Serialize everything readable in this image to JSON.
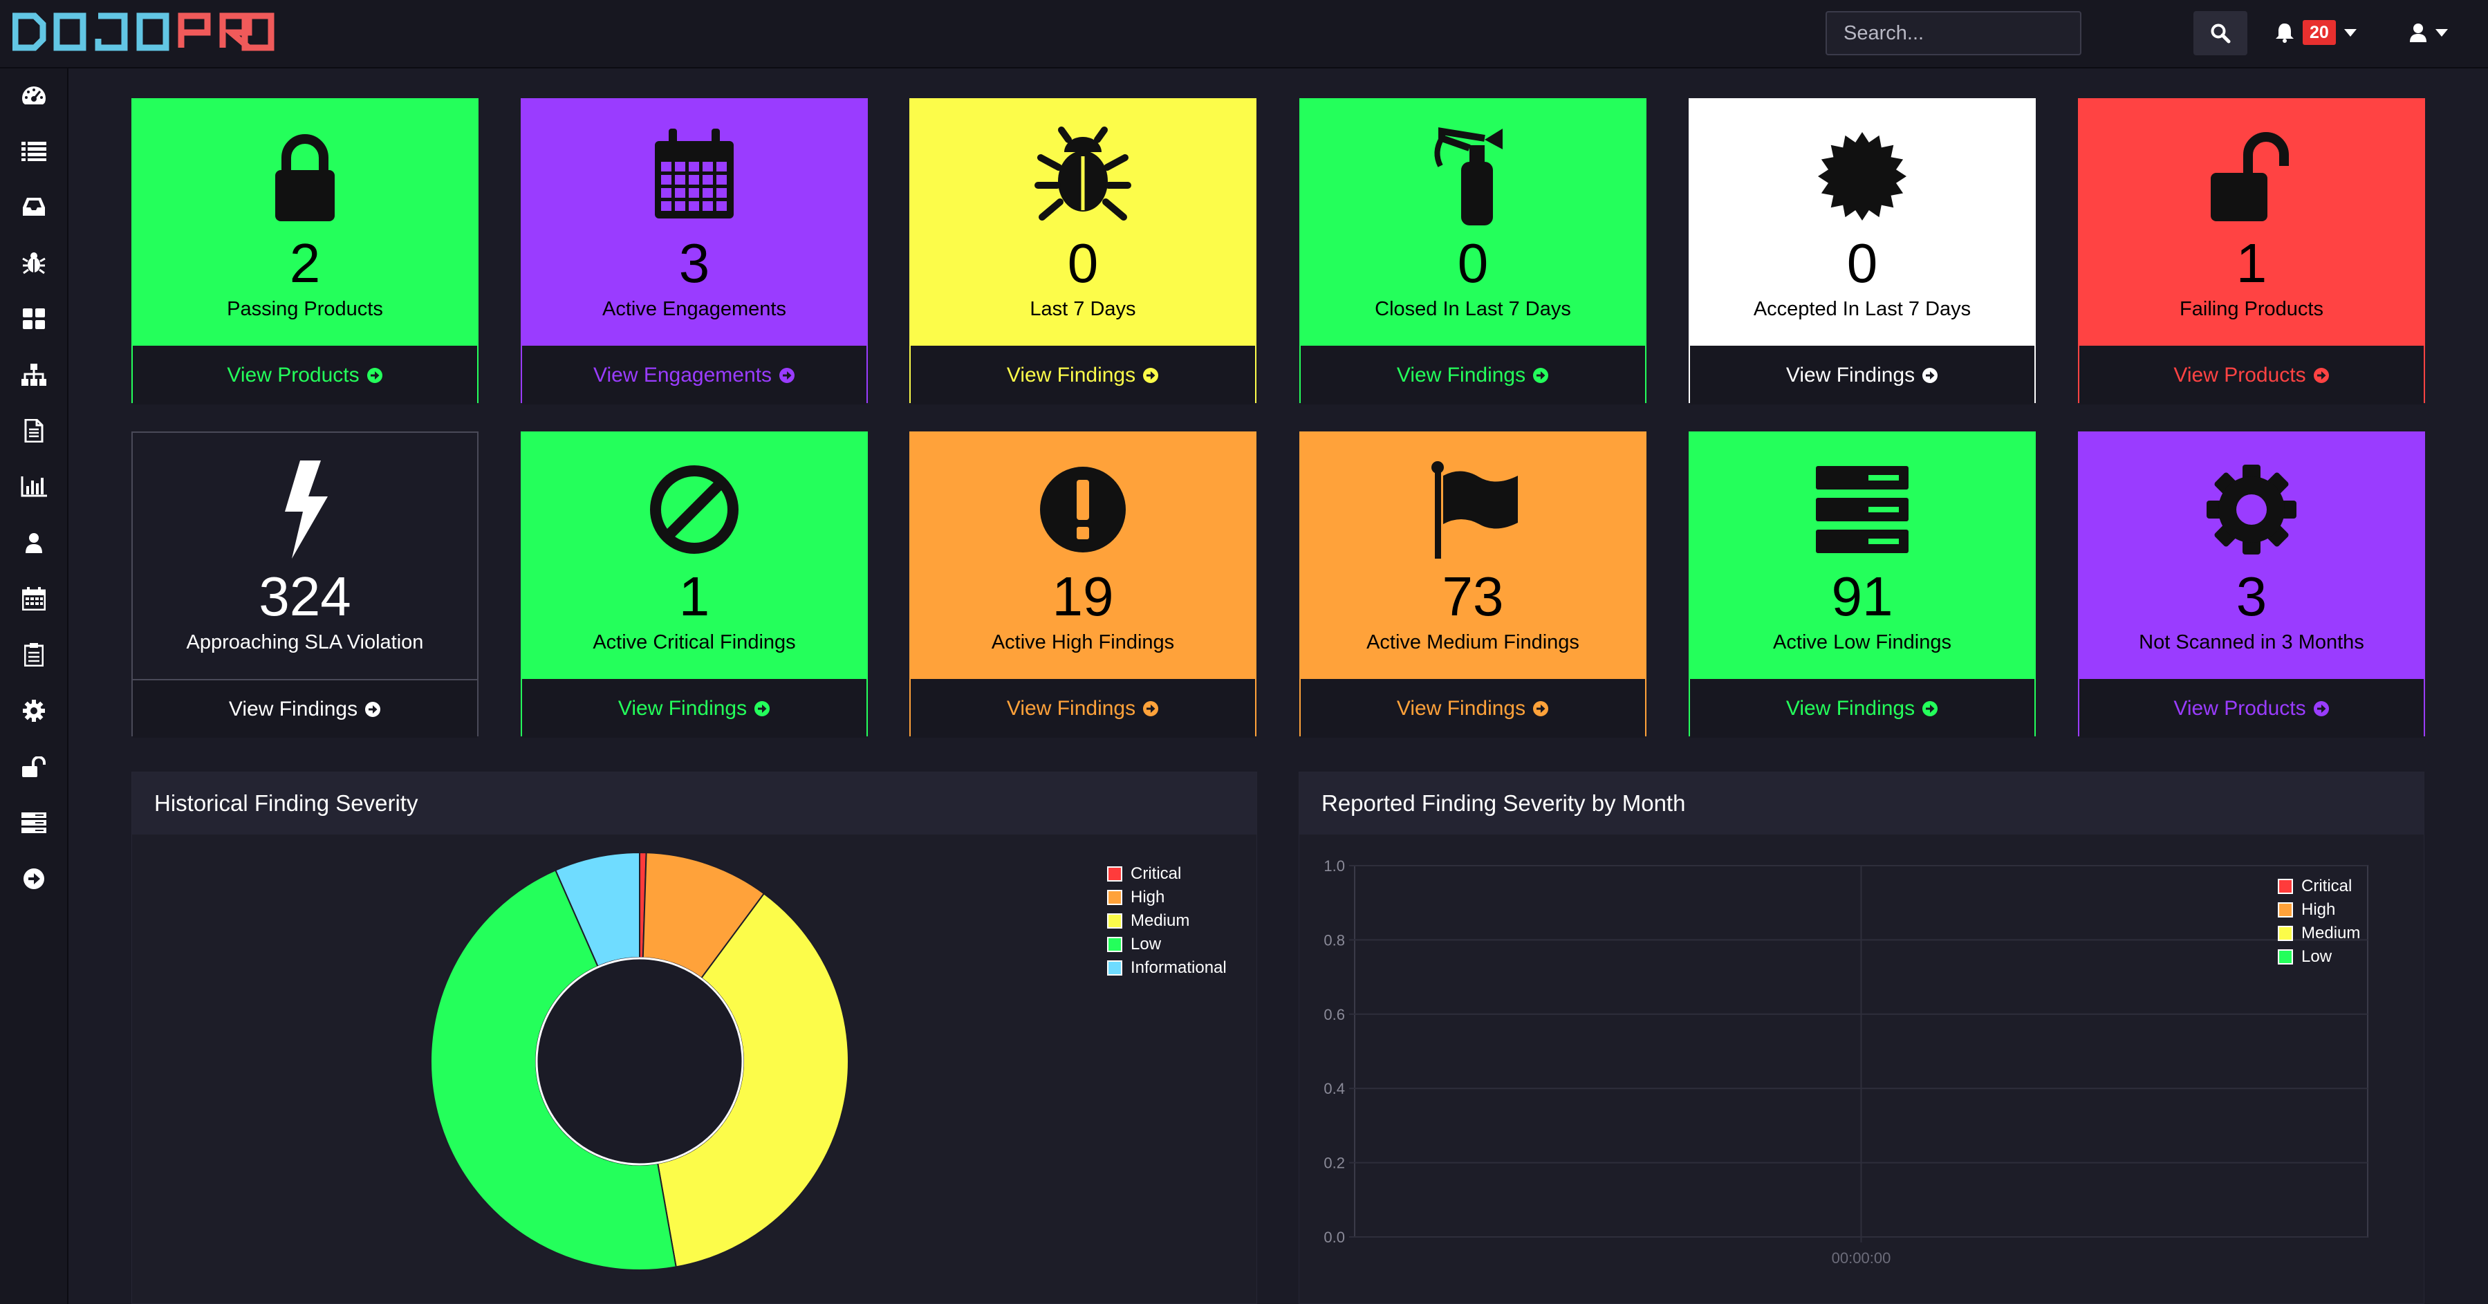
{
  "app": {
    "logo": {
      "part1": "DOJO",
      "part2": "PRO"
    },
    "search": {
      "placeholder": "Search..."
    },
    "notifications": {
      "count": "20"
    }
  },
  "sidebar": {
    "items": [
      {
        "icon": "dashboard-icon"
      },
      {
        "icon": "list-icon"
      },
      {
        "icon": "inbox-icon"
      },
      {
        "icon": "bug-icon"
      },
      {
        "icon": "grid-icon"
      },
      {
        "icon": "sitemap-icon"
      },
      {
        "icon": "file-icon"
      },
      {
        "icon": "bar-chart-icon"
      },
      {
        "icon": "user-icon"
      },
      {
        "icon": "calendar-icon"
      },
      {
        "icon": "clipboard-icon"
      },
      {
        "icon": "gear-icon"
      },
      {
        "icon": "unlock-icon"
      },
      {
        "icon": "server-icon"
      },
      {
        "icon": "arrow-circle-right-icon"
      }
    ]
  },
  "tiles": [
    {
      "count": "2",
      "label": "Passing Products",
      "link": "View Products",
      "icon": "lock-icon",
      "color": "#24ff5b"
    },
    {
      "count": "3",
      "label": "Active Engagements",
      "link": "View Engagements",
      "icon": "calendar-icon",
      "color": "#9a3cff"
    },
    {
      "count": "0",
      "label": "Last 7 Days",
      "link": "View Findings",
      "icon": "bug-icon",
      "color": "#fcfc4a"
    },
    {
      "count": "0",
      "label": "Closed In Last 7 Days",
      "link": "View Findings",
      "icon": "fire-extinguisher-icon",
      "color": "#24ff5b"
    },
    {
      "count": "0",
      "label": "Accepted In Last 7 Days",
      "link": "View Findings",
      "icon": "certificate-icon",
      "color": "#ffffff"
    },
    {
      "count": "1",
      "label": "Failing Products",
      "link": "View Products",
      "icon": "unlock-icon",
      "color": "#ff4343"
    },
    {
      "count": "324",
      "label": "Approaching SLA Violation",
      "link": "View Findings",
      "icon": "bolt-icon",
      "color": "#1b1b26"
    },
    {
      "count": "1",
      "label": "Active Critical Findings",
      "link": "View Findings",
      "icon": "ban-icon",
      "color": "#24ff5b"
    },
    {
      "count": "19",
      "label": "Active High Findings",
      "link": "View Findings",
      "icon": "exclamation-circle-icon",
      "color": "#ffa23a"
    },
    {
      "count": "73",
      "label": "Active Medium Findings",
      "link": "View Findings",
      "icon": "flag-icon",
      "color": "#ffa23a"
    },
    {
      "count": "91",
      "label": "Active Low Findings",
      "link": "View Findings",
      "icon": "server-icon",
      "color": "#24ff5b"
    },
    {
      "count": "3",
      "label": "Not Scanned in 3 Months",
      "link": "View Products",
      "icon": "gear-icon",
      "color": "#9a3cff"
    }
  ],
  "panels": {
    "historical": {
      "title": "Historical Finding Severity"
    },
    "monthly": {
      "title": "Reported Finding Severity by Month"
    }
  },
  "chart_data": [
    {
      "type": "pie",
      "title": "Historical Finding Severity",
      "categories": [
        "Critical",
        "High",
        "Medium",
        "Low",
        "Informational"
      ],
      "values": [
        1,
        19,
        73,
        91,
        13
      ],
      "colors": [
        "#ff3b3b",
        "#ffa23a",
        "#fcfc4a",
        "#24ff5b",
        "#6fdcff"
      ],
      "legend": "top-right"
    },
    {
      "type": "line",
      "title": "Reported Finding Severity by Month",
      "x": [
        "00:00:00"
      ],
      "series": [
        {
          "name": "Critical",
          "values": [],
          "color": "#ff3b3b"
        },
        {
          "name": "High",
          "values": [],
          "color": "#ffa23a"
        },
        {
          "name": "Medium",
          "values": [],
          "color": "#fcfc4a"
        },
        {
          "name": "Low",
          "values": [],
          "color": "#24ff5b"
        }
      ],
      "ylim": [
        0,
        1.0
      ],
      "yticks": [
        "1.0",
        "0.8",
        "0.6",
        "0.4",
        "0.2",
        "0.0"
      ],
      "legend": "top-right",
      "grid": true
    }
  ]
}
